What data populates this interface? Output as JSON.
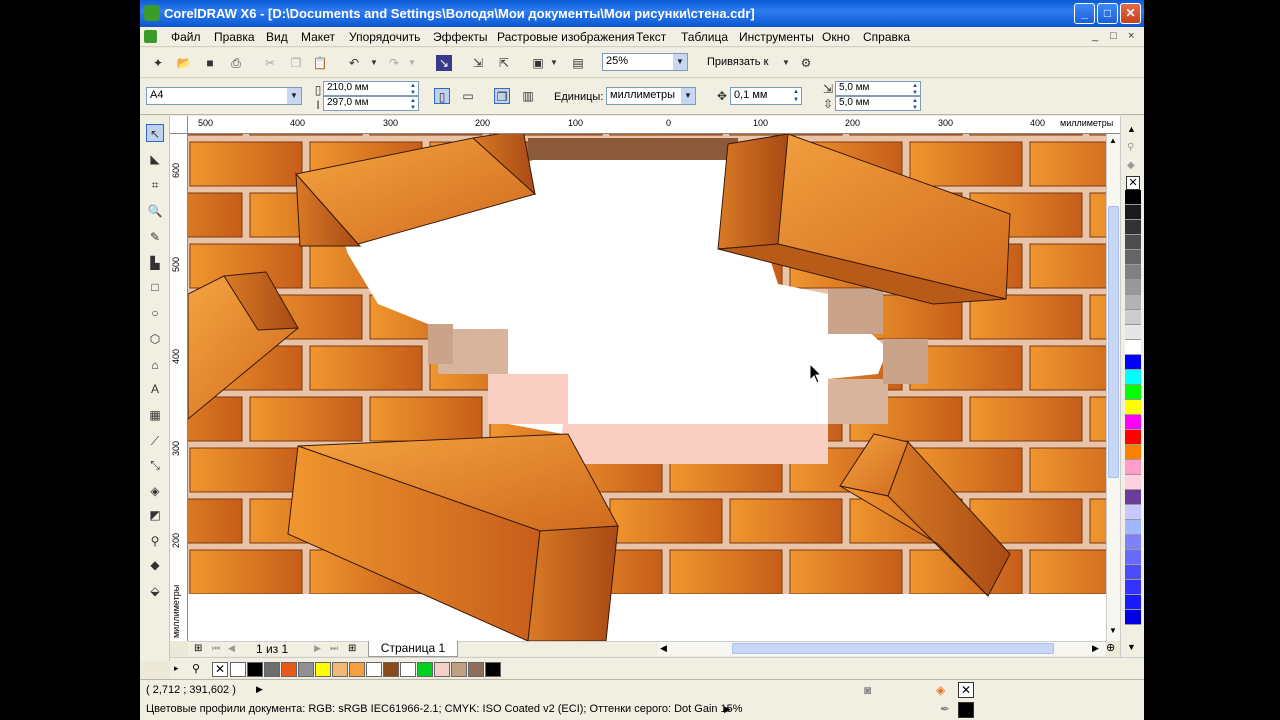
{
  "window": {
    "title": "CorelDRAW X6 - [D:\\Documents and Settings\\Володя\\Мои документы\\Мои рисунки\\стена.cdr]",
    "minimize": "_",
    "maximize": "□",
    "close": "✕"
  },
  "menu": {
    "items": [
      "Файл",
      "Правка",
      "Вид",
      "Макет",
      "Упорядочить",
      "Эффекты",
      "Растровые изображения",
      "Текст",
      "Таблица",
      "Инструменты",
      "Окно",
      "Справка"
    ],
    "mdi": [
      "_",
      "□",
      "×"
    ]
  },
  "toolbar": {
    "zoom": "25%",
    "snap_label": "Привязать к"
  },
  "property_bar": {
    "page_size": "A4",
    "width": "210,0 мм",
    "height": "297,0 мм",
    "units_label": "Единицы:",
    "units": "миллиметры",
    "nudge": "0,1 мм",
    "dup_x": "5,0 мм",
    "dup_y": "5,0 мм"
  },
  "rulers": {
    "unit_label": "миллиметры",
    "h_ticks": [
      "500",
      "400",
      "300",
      "200",
      "100",
      "0",
      "100",
      "200",
      "300",
      "400"
    ],
    "v_ticks": [
      "600",
      "500",
      "400",
      "300",
      "200"
    ],
    "v_unit_label": "миллиметры"
  },
  "page_nav": {
    "counter": "1 из 1",
    "tab": "Страница 1"
  },
  "status": {
    "coords": "( 2,712 ; 391,602 )",
    "profile": "Цветовые профили документа: RGB: sRGB IEC61966-2.1; CMYK: ISO Coated v2 (ECI); Оттенки серого: Dot Gain 15%"
  },
  "colors": {
    "brick_light": "#e88a2a",
    "brick_dark": "#c55f18",
    "mortar": "#e9c3a8",
    "title_blue": "#0b57d0"
  },
  "palette_colors": [
    "#000000",
    "#1a1a1a",
    "#333333",
    "#4d4d4d",
    "#666666",
    "#808080",
    "#999999",
    "#b3b3b3",
    "#cccccc",
    "#e6e6e6",
    "#ffffff",
    "#0000ff",
    "#00ffff",
    "#00ff00",
    "#ffff00",
    "#ff00ff",
    "#ff0000",
    "#ff7f00",
    "#ff9ec8",
    "#ffd1e0",
    "#6a3d9a",
    "#c8c8ff",
    "#a0b8ff",
    "#8080ff",
    "#6a6aff",
    "#4d4dff",
    "#3333ff",
    "#1a1aff",
    "#0000e0"
  ],
  "doc_colors": [
    "#ffffff",
    "#000000",
    "#6e6e6e",
    "#e85a1a",
    "#909090",
    "#ffff00",
    "#f0b878",
    "#f4a040",
    "#ffffff",
    "#8a4a1a",
    "#ffffff",
    "#00d020",
    "#f4d0c8",
    "#c0a080",
    "#8c6e5a",
    "#000000"
  ]
}
